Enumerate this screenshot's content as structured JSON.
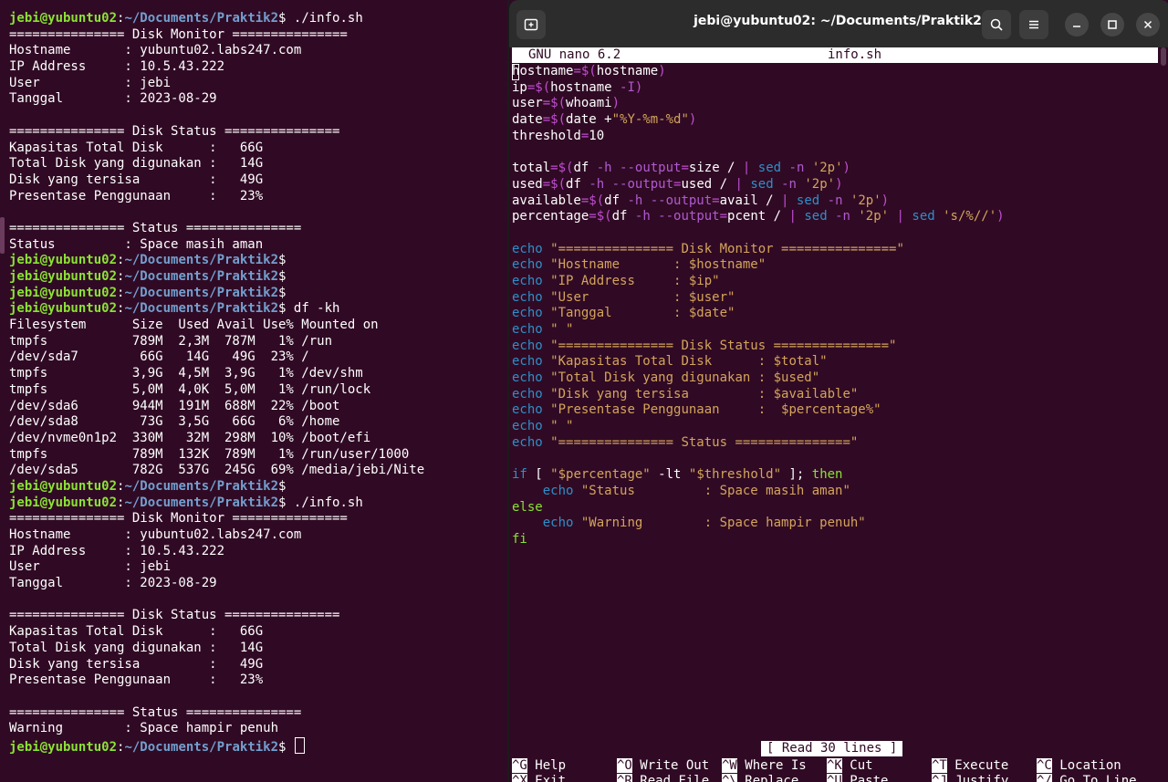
{
  "left_terminal": {
    "prompt_user": "jebi@yubuntu02",
    "prompt_path": "~/Documents/Praktik2",
    "lines": [
      {
        "p": true,
        "cmd": " ./info.sh"
      },
      {
        "t": "=============== Disk Monitor ==============="
      },
      {
        "t": "Hostname       : yubuntu02.labs247.com"
      },
      {
        "t": "IP Address     : 10.5.43.222"
      },
      {
        "t": "User           : jebi"
      },
      {
        "t": "Tanggal        : 2023-08-29"
      },
      {
        "t": ""
      },
      {
        "t": "=============== Disk Status ==============="
      },
      {
        "t": "Kapasitas Total Disk      :   66G"
      },
      {
        "t": "Total Disk yang digunakan :   14G"
      },
      {
        "t": "Disk yang tersisa         :   49G"
      },
      {
        "t": "Presentase Penggunaan     :   23%"
      },
      {
        "t": ""
      },
      {
        "t": "=============== Status ==============="
      },
      {
        "t": "Status         : Space masih aman"
      },
      {
        "p": true,
        "cmd": ""
      },
      {
        "p": true,
        "cmd": ""
      },
      {
        "p": true,
        "cmd": ""
      },
      {
        "p": true,
        "cmd": " df -kh"
      },
      {
        "t": "Filesystem      Size  Used Avail Use% Mounted on"
      },
      {
        "t": "tmpfs           789M  2,3M  787M   1% /run"
      },
      {
        "t": "/dev/sda7        66G   14G   49G  23% /"
      },
      {
        "t": "tmpfs           3,9G  4,5M  3,9G   1% /dev/shm"
      },
      {
        "t": "tmpfs           5,0M  4,0K  5,0M   1% /run/lock"
      },
      {
        "t": "/dev/sda6       944M  191M  688M  22% /boot"
      },
      {
        "t": "/dev/sda8        73G  3,5G   66G   6% /home"
      },
      {
        "t": "/dev/nvme0n1p2  330M   32M  298M  10% /boot/efi"
      },
      {
        "t": "tmpfs           789M  132K  789M   1% /run/user/1000"
      },
      {
        "t": "/dev/sda5       782G  537G  245G  69% /media/jebi/Nite"
      },
      {
        "p": true,
        "cmd": ""
      },
      {
        "p": true,
        "cmd": " ./info.sh"
      },
      {
        "t": "=============== Disk Monitor ==============="
      },
      {
        "t": "Hostname       : yubuntu02.labs247.com"
      },
      {
        "t": "IP Address     : 10.5.43.222"
      },
      {
        "t": "User           : jebi"
      },
      {
        "t": "Tanggal        : 2023-08-29"
      },
      {
        "t": ""
      },
      {
        "t": "=============== Disk Status ==============="
      },
      {
        "t": "Kapasitas Total Disk      :   66G"
      },
      {
        "t": "Total Disk yang digunakan :   14G"
      },
      {
        "t": "Disk yang tersisa         :   49G"
      },
      {
        "t": "Presentase Penggunaan     :   23%"
      },
      {
        "t": ""
      },
      {
        "t": "=============== Status ==============="
      },
      {
        "t": "Warning        : Space hampir penuh"
      },
      {
        "p": true,
        "cmd": " ",
        "cursor": true
      }
    ]
  },
  "right_window": {
    "title": "jebi@yubuntu02: ~/Documents/Praktik2",
    "icons": {
      "new_tab": "new-tab-icon",
      "search": "search-icon",
      "menu": "hamburger-menu-icon",
      "minimize": "minimize-icon",
      "maximize": "maximize-icon",
      "close": "close-icon"
    },
    "nano_version": "GNU nano 6.2",
    "file_name": "info.sh",
    "status_message": "[ Read 30 lines ]",
    "code": [
      [
        [
          "vr",
          "h"
        ],
        [
          "vr",
          "ostname"
        ],
        [
          "op",
          "=$("
        ],
        [
          "vr",
          "hostname"
        ],
        [
          "op",
          ")"
        ]
      ],
      [
        [
          "vr",
          "ip"
        ],
        [
          "op",
          "=$("
        ],
        [
          "vr",
          "hostname "
        ],
        [
          "fl",
          "-I"
        ],
        [
          "op",
          ")"
        ]
      ],
      [
        [
          "vr",
          "user"
        ],
        [
          "op",
          "=$("
        ],
        [
          "vr",
          "whoami"
        ],
        [
          "op",
          ")"
        ]
      ],
      [
        [
          "vr",
          "date"
        ],
        [
          "op",
          "=$("
        ],
        [
          "vr",
          "date +"
        ],
        [
          "st",
          "\"%Y-%m-%d\""
        ],
        [
          "op",
          ")"
        ]
      ],
      [
        [
          "vr",
          "threshold"
        ],
        [
          "op",
          "="
        ],
        [
          "vr",
          "10"
        ]
      ],
      [],
      [
        [
          "vr",
          "total"
        ],
        [
          "op",
          "=$("
        ],
        [
          "vr",
          "df "
        ],
        [
          "fl",
          "-h --output"
        ],
        [
          "op",
          "="
        ],
        [
          "vr",
          "size / "
        ],
        [
          "op",
          "| "
        ],
        [
          "kw",
          "sed"
        ],
        [
          "vr",
          " "
        ],
        [
          "fl",
          "-n"
        ],
        [
          "vr",
          " "
        ],
        [
          "st",
          "'2p'"
        ],
        [
          "op",
          ")"
        ]
      ],
      [
        [
          "vr",
          "used"
        ],
        [
          "op",
          "=$("
        ],
        [
          "vr",
          "df "
        ],
        [
          "fl",
          "-h --output"
        ],
        [
          "op",
          "="
        ],
        [
          "vr",
          "used / "
        ],
        [
          "op",
          "| "
        ],
        [
          "kw",
          "sed"
        ],
        [
          "vr",
          " "
        ],
        [
          "fl",
          "-n"
        ],
        [
          "vr",
          " "
        ],
        [
          "st",
          "'2p'"
        ],
        [
          "op",
          ")"
        ]
      ],
      [
        [
          "vr",
          "available"
        ],
        [
          "op",
          "=$("
        ],
        [
          "vr",
          "df "
        ],
        [
          "fl",
          "-h --output"
        ],
        [
          "op",
          "="
        ],
        [
          "vr",
          "avail / "
        ],
        [
          "op",
          "| "
        ],
        [
          "kw",
          "sed"
        ],
        [
          "vr",
          " "
        ],
        [
          "fl",
          "-n"
        ],
        [
          "vr",
          " "
        ],
        [
          "st",
          "'2p'"
        ],
        [
          "op",
          ")"
        ]
      ],
      [
        [
          "vr",
          "percentage"
        ],
        [
          "op",
          "=$("
        ],
        [
          "vr",
          "df "
        ],
        [
          "fl",
          "-h --output"
        ],
        [
          "op",
          "="
        ],
        [
          "vr",
          "pcent / "
        ],
        [
          "op",
          "| "
        ],
        [
          "kw",
          "sed"
        ],
        [
          "vr",
          " "
        ],
        [
          "fl",
          "-n"
        ],
        [
          "vr",
          " "
        ],
        [
          "st",
          "'2p'"
        ],
        [
          "vr",
          " "
        ],
        [
          "op",
          "| "
        ],
        [
          "kw",
          "sed"
        ],
        [
          "vr",
          " "
        ],
        [
          "st",
          "'s/%//'"
        ],
        [
          "op",
          ")"
        ]
      ],
      [],
      [
        [
          "kw",
          "echo"
        ],
        [
          "vr",
          " "
        ],
        [
          "st",
          "\"=============== Disk Monitor ===============\""
        ]
      ],
      [
        [
          "kw",
          "echo"
        ],
        [
          "vr",
          " "
        ],
        [
          "st",
          "\"Hostname       : $hostname\""
        ]
      ],
      [
        [
          "kw",
          "echo"
        ],
        [
          "vr",
          " "
        ],
        [
          "st",
          "\"IP Address     : $ip\""
        ]
      ],
      [
        [
          "kw",
          "echo"
        ],
        [
          "vr",
          " "
        ],
        [
          "st",
          "\"User           : $user\""
        ]
      ],
      [
        [
          "kw",
          "echo"
        ],
        [
          "vr",
          " "
        ],
        [
          "st",
          "\"Tanggal        : $date\""
        ]
      ],
      [
        [
          "kw",
          "echo"
        ],
        [
          "vr",
          " "
        ],
        [
          "st",
          "\" \""
        ]
      ],
      [
        [
          "kw",
          "echo"
        ],
        [
          "vr",
          " "
        ],
        [
          "st",
          "\"=============== Disk Status ===============\""
        ]
      ],
      [
        [
          "kw",
          "echo"
        ],
        [
          "vr",
          " "
        ],
        [
          "st",
          "\"Kapasitas Total Disk      : $total\""
        ]
      ],
      [
        [
          "kw",
          "echo"
        ],
        [
          "vr",
          " "
        ],
        [
          "st",
          "\"Total Disk yang digunakan : $used\""
        ]
      ],
      [
        [
          "kw",
          "echo"
        ],
        [
          "vr",
          " "
        ],
        [
          "st",
          "\"Disk yang tersisa         : $available\""
        ]
      ],
      [
        [
          "kw",
          "echo"
        ],
        [
          "vr",
          " "
        ],
        [
          "st",
          "\"Presentase Penggunaan     :  $percentage%\""
        ]
      ],
      [
        [
          "kw",
          "echo"
        ],
        [
          "vr",
          " "
        ],
        [
          "st",
          "\" \""
        ]
      ],
      [
        [
          "kw",
          "echo"
        ],
        [
          "vr",
          " "
        ],
        [
          "st",
          "\"=============== Status ===============\""
        ]
      ],
      [],
      [
        [
          "kw",
          "if"
        ],
        [
          "vr",
          " [ "
        ],
        [
          "st",
          "\"$percentage\""
        ],
        [
          "vr",
          " -lt "
        ],
        [
          "st",
          "\"$threshold\""
        ],
        [
          "vr",
          " ]; "
        ],
        [
          "gr",
          "then"
        ]
      ],
      [
        [
          "vr",
          "    "
        ],
        [
          "kw",
          "echo"
        ],
        [
          "vr",
          " "
        ],
        [
          "st",
          "\"Status         : Space masih aman\""
        ]
      ],
      [
        [
          "gr",
          "else"
        ]
      ],
      [
        [
          "vr",
          "    "
        ],
        [
          "kw",
          "echo"
        ],
        [
          "vr",
          " "
        ],
        [
          "st",
          "\"Warning        : Space hampir penuh\""
        ]
      ],
      [
        [
          "gr",
          "fi"
        ]
      ]
    ],
    "shortcuts": {
      "row1": [
        {
          "key": "^G",
          "label": "Help"
        },
        {
          "key": "^O",
          "label": "Write Out"
        },
        {
          "key": "^W",
          "label": "Where Is"
        },
        {
          "key": "^K",
          "label": "Cut"
        },
        {
          "key": "^T",
          "label": "Execute"
        },
        {
          "key": "^C",
          "label": "Location"
        }
      ],
      "row2": [
        {
          "key": "^X",
          "label": "Exit"
        },
        {
          "key": "^R",
          "label": "Read File"
        },
        {
          "key": "^\\",
          "label": "Replace"
        },
        {
          "key": "^U",
          "label": "Paste"
        },
        {
          "key": "^J",
          "label": "Justify"
        },
        {
          "key": "^/",
          "label": "Go To Line"
        }
      ]
    }
  }
}
